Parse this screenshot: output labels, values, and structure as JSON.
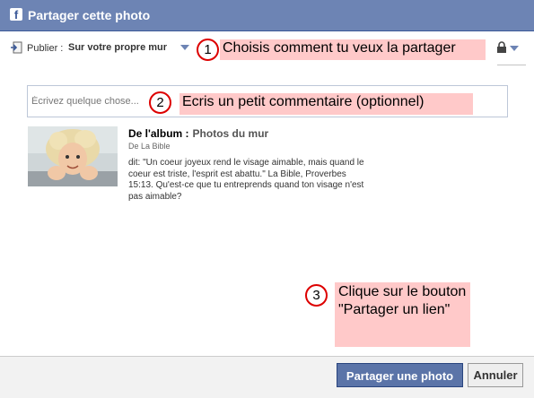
{
  "dialog": {
    "title": "Partager cette photo",
    "brand_letter": "f"
  },
  "publisher": {
    "label": "Publier :",
    "target": "Sur votre propre mur"
  },
  "composer": {
    "placeholder": "Écrivez quelque chose..."
  },
  "attachment": {
    "album_label": "De l'album :",
    "album_name": "Photos du mur",
    "owner": "De La Bible",
    "description": "dit: \"Un coeur joyeux rend le visage aimable, mais quand le coeur est triste, l'esprit est abattu.\" La Bible, Proverbes 15:13. Qu'est-ce que tu entreprends quand ton visage n'est pas aimable?"
  },
  "annotations": [
    {
      "number": "1",
      "text": "Choisis comment tu veux la partager"
    },
    {
      "number": "2",
      "text": "Ecris un petit commentaire (optionnel)"
    },
    {
      "number": "3",
      "text": "Clique sur le bouton \"Partager un lien\""
    }
  ],
  "buttons": {
    "share": "Partager une photo",
    "cancel": "Annuler"
  },
  "colors": {
    "header": "#6d84b4",
    "annotation_bg": "#ffc9c9",
    "annotation_ring": "#dd0000",
    "primary_button": "#5b74a8"
  },
  "icons": [
    "facebook-logo-icon",
    "publish-icon",
    "chevron-down-icon",
    "lock-icon"
  ]
}
